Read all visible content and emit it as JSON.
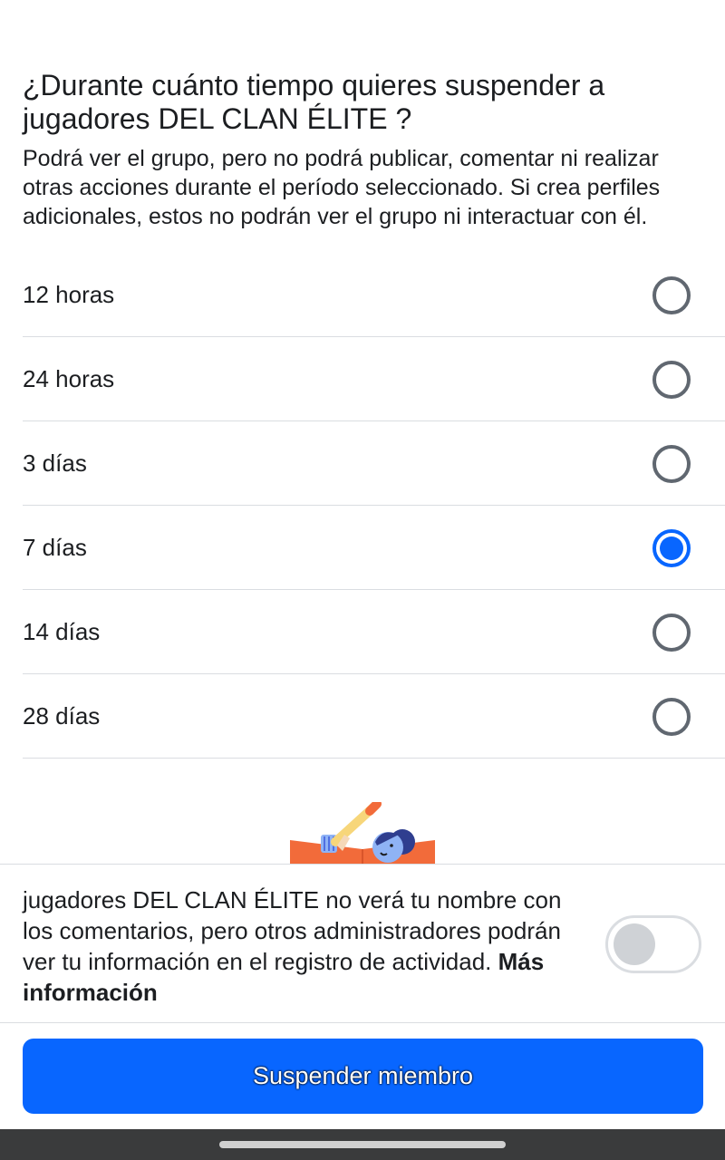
{
  "question": {
    "title": "¿Durante cuánto tiempo quieres suspender a jugadores DEL CLAN ÉLITE ?",
    "description": "Podrá ver el grupo, pero no podrá publicar, comentar ni realizar otras acciones durante el período seleccionado. Si crea perfiles adicionales, estos no podrán ver el grupo ni interactuar con él."
  },
  "options": [
    {
      "label": "12 horas",
      "selected": false
    },
    {
      "label": "24 horas",
      "selected": false
    },
    {
      "label": "3 días",
      "selected": false
    },
    {
      "label": "7 días",
      "selected": true
    },
    {
      "label": "14 días",
      "selected": false
    },
    {
      "label": "28 días",
      "selected": false
    }
  ],
  "privacy": {
    "text": "jugadores DEL CLAN ÉLITE  no verá tu nombre con los comentarios, pero otros administradores podrán ver tu información en el registro de actividad.",
    "link": "Más información",
    "toggle_on": false
  },
  "action": {
    "label": "Suspender miembro"
  },
  "colors": {
    "accent": "#0866ff",
    "text": "#1c1e21",
    "divider": "#dadde1",
    "radio_unselected": "#606770",
    "illustration_orange": "#f26b3a",
    "illustration_blue": "#3b5bdb"
  }
}
